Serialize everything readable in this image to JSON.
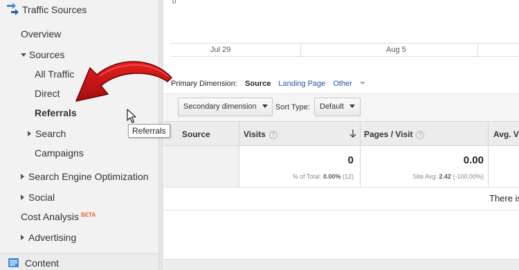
{
  "sidebar": {
    "section_title": "Traffic Sources",
    "icon": "traffic-sources-arrows-icon",
    "items": [
      {
        "label": "Overview"
      },
      {
        "label": "Sources"
      },
      {
        "label": "All Traffic"
      },
      {
        "label": "Direct"
      },
      {
        "label": "Referrals"
      },
      {
        "label": "Search"
      },
      {
        "label": "Campaigns"
      },
      {
        "label": "Search Engine Optimization"
      },
      {
        "label": "Social"
      },
      {
        "label": "Cost Analysis",
        "badge": "BETA"
      },
      {
        "label": "Advertising"
      }
    ],
    "next_section": "Content",
    "tooltip": "Referrals"
  },
  "chart": {
    "y_tick": "0",
    "x_labels": [
      "Jul 29",
      "Aug 5"
    ]
  },
  "dimension": {
    "label": "Primary Dimension:",
    "active": "Source",
    "options": [
      "Landing Page",
      "Other"
    ]
  },
  "controls": {
    "secondary": "Secondary dimension",
    "sort_label": "Sort Type:",
    "sort_value": "Default"
  },
  "table": {
    "columns": [
      "Source",
      "Visits",
      "Pages / Visit",
      "Avg. V"
    ],
    "totals": {
      "visits": "0",
      "visits_pct_label": "% of Total:",
      "visits_pct": "0.00%",
      "visits_count": "(12)",
      "pages_visit": "0.00",
      "pages_avg_label": "Site Avg:",
      "pages_avg": "2.42",
      "pages_avg_delta": "(-100.00%)"
    },
    "empty_message": "There is"
  },
  "colors": {
    "link": "#1a55b1",
    "beta": "#e8632b",
    "arrow": "#cc1111"
  }
}
